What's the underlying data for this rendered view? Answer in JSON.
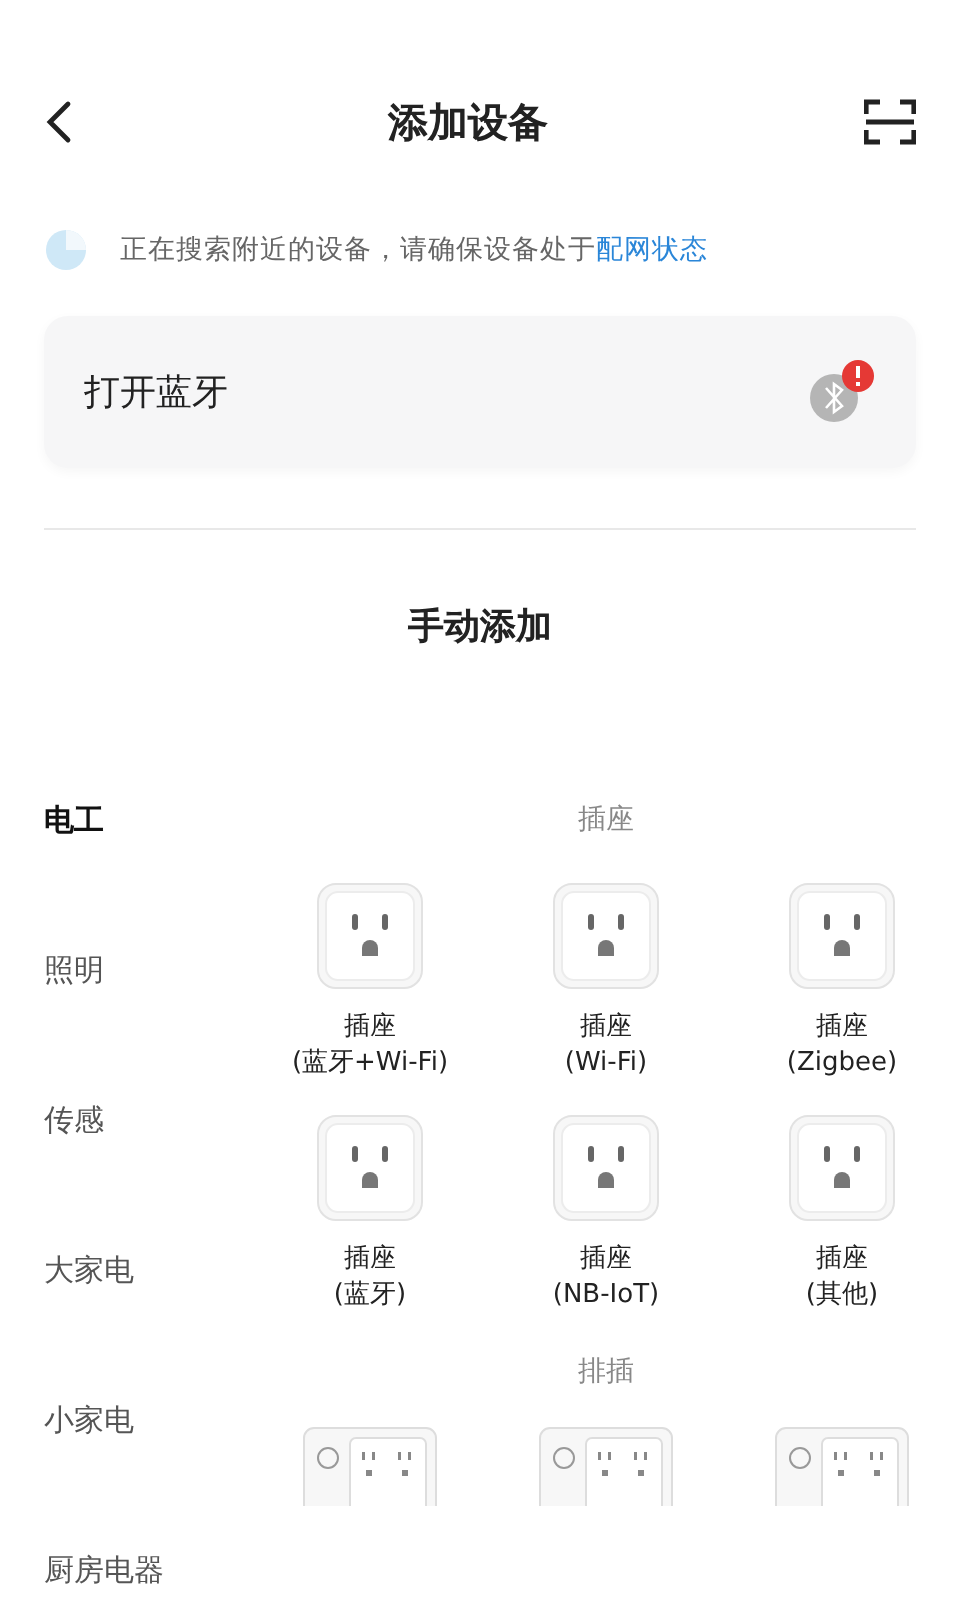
{
  "header": {
    "title": "添加设备"
  },
  "search_hint": {
    "text": "正在搜索附近的设备，请确保设备处于",
    "link": "配网状态"
  },
  "bluetooth_card": {
    "label": "打开蓝牙",
    "alert": true
  },
  "manual": {
    "title": "手动添加"
  },
  "categories": [
    {
      "label": "电工",
      "selected": true
    },
    {
      "label": "照明",
      "selected": false
    },
    {
      "label": "传感",
      "selected": false
    },
    {
      "label": "大家电",
      "selected": false
    },
    {
      "label": "小家电",
      "selected": false
    },
    {
      "label": "厨房电器",
      "selected": false
    }
  ],
  "sections": [
    {
      "title": "插座",
      "items": [
        {
          "kind": "socket",
          "name": "插座",
          "variant": "(蓝牙+Wi-Fi)"
        },
        {
          "kind": "socket",
          "name": "插座",
          "variant": "(Wi-Fi)"
        },
        {
          "kind": "socket",
          "name": "插座",
          "variant": "(Zigbee)"
        },
        {
          "kind": "socket",
          "name": "插座",
          "variant": "(蓝牙)"
        },
        {
          "kind": "socket",
          "name": "插座",
          "variant": "(NB-IoT)"
        },
        {
          "kind": "socket",
          "name": "插座",
          "variant": "(其他)"
        }
      ]
    },
    {
      "title": "排插",
      "items": [
        {
          "kind": "strip"
        },
        {
          "kind": "strip"
        },
        {
          "kind": "strip"
        }
      ]
    }
  ]
}
